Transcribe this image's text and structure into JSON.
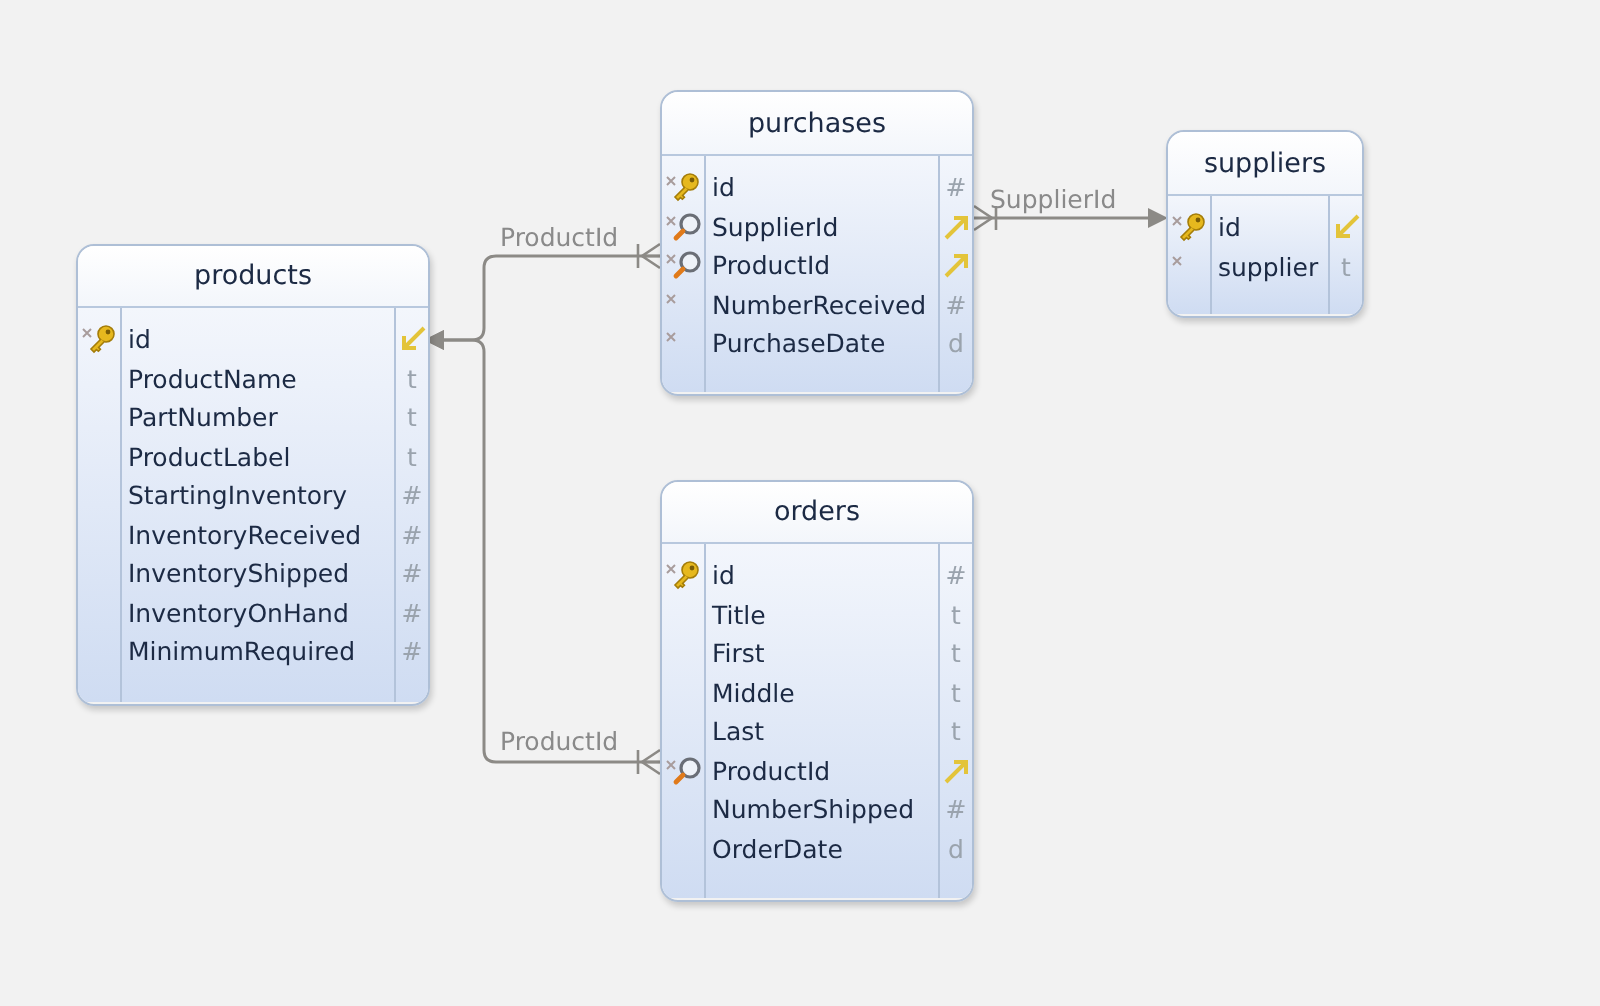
{
  "tables": [
    {
      "name": "products",
      "fields": [
        {
          "name": "id",
          "kind": "primary",
          "required": true,
          "linked": true
        },
        {
          "name": "ProductName",
          "kind": "plain",
          "required": false,
          "type": "t"
        },
        {
          "name": "PartNumber",
          "kind": "plain",
          "required": false,
          "type": "t"
        },
        {
          "name": "ProductLabel",
          "kind": "plain",
          "required": false,
          "type": "t"
        },
        {
          "name": "StartingInventory",
          "kind": "plain",
          "required": false,
          "type": "#"
        },
        {
          "name": "InventoryReceived",
          "kind": "plain",
          "required": false,
          "type": "#"
        },
        {
          "name": "InventoryShipped",
          "kind": "plain",
          "required": false,
          "type": "#"
        },
        {
          "name": "InventoryOnHand",
          "kind": "plain",
          "required": false,
          "type": "#"
        },
        {
          "name": "MinimumRequired",
          "kind": "plain",
          "required": false,
          "type": "#"
        }
      ]
    },
    {
      "name": "purchases",
      "fields": [
        {
          "name": "id",
          "kind": "primary",
          "required": true,
          "type": "#"
        },
        {
          "name": "SupplierId",
          "kind": "foreign",
          "required": true,
          "linked": true
        },
        {
          "name": "ProductId",
          "kind": "foreign",
          "required": true,
          "linked": true
        },
        {
          "name": "NumberReceived",
          "kind": "plain",
          "required": true,
          "type": "#"
        },
        {
          "name": "PurchaseDate",
          "kind": "plain",
          "required": true,
          "type": "d"
        }
      ]
    },
    {
      "name": "suppliers",
      "fields": [
        {
          "name": "id",
          "kind": "primary",
          "required": true,
          "linked": true
        },
        {
          "name": "supplier",
          "kind": "plain",
          "required": true,
          "type": "t"
        }
      ]
    },
    {
      "name": "orders",
      "fields": [
        {
          "name": "id",
          "kind": "primary",
          "required": true,
          "type": "#"
        },
        {
          "name": "Title",
          "kind": "plain",
          "required": false,
          "type": "t"
        },
        {
          "name": "First",
          "kind": "plain",
          "required": false,
          "type": "t"
        },
        {
          "name": "Middle",
          "kind": "plain",
          "required": false,
          "type": "t"
        },
        {
          "name": "Last",
          "kind": "plain",
          "required": false,
          "type": "t"
        },
        {
          "name": "ProductId",
          "kind": "foreign",
          "required": true,
          "linked": true
        },
        {
          "name": "NumberShipped",
          "kind": "plain",
          "required": false,
          "type": "#"
        },
        {
          "name": "OrderDate",
          "kind": "plain",
          "required": false,
          "type": "d"
        }
      ]
    }
  ],
  "relationships": [
    {
      "label": "ProductId"
    },
    {
      "label": "ProductId"
    },
    {
      "label": "SupplierId"
    }
  ]
}
